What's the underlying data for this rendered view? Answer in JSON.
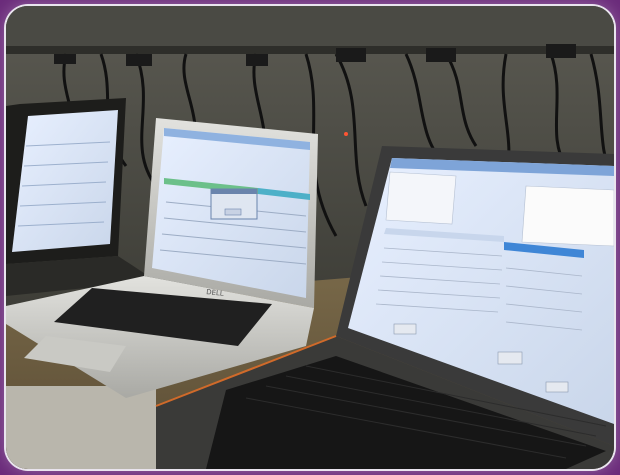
{
  "photo": {
    "frame_color": "#e9e4ee",
    "background_color": "#6a2a7a",
    "laptops": [
      {
        "name": "far-laptop",
        "screen": "on"
      },
      {
        "name": "middle-laptop",
        "brand": "DELL",
        "screen": "on",
        "dialog": "visible"
      },
      {
        "name": "near-laptop",
        "screen": "on"
      }
    ]
  }
}
